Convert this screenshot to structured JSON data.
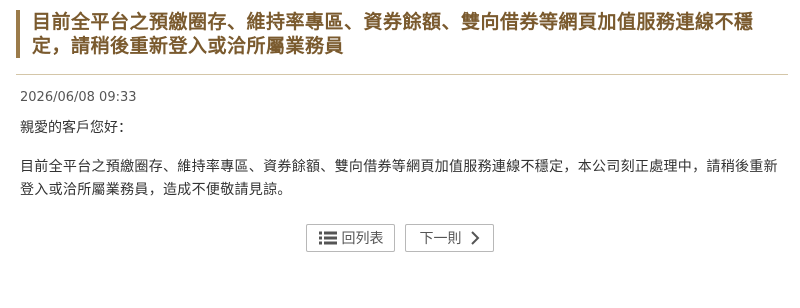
{
  "announcement": {
    "title": "目前全平台之預繳圈存、維持率專區、資券餘額、雙向借券等網頁加值服務連線不穩定，請稍後重新登入或洽所屬業務員",
    "date": "2026/06/08 09:33",
    "greeting": "親愛的客戶您好：",
    "body": "目前全平台之預繳圈存、維持率專區、資券餘額、雙向借券等網頁加值服務連線不穩定，本公司刻正處理中，請稍後重新登入或洽所屬業務員，造成不便敬請見諒。"
  },
  "navigation": {
    "back_label": "回列表",
    "back_icon": "list-icon",
    "next_label": "下一則",
    "next_icon": "chevron-right-icon"
  },
  "colors": {
    "accent": "#9b7b4a",
    "title": "#7a5a2e"
  }
}
